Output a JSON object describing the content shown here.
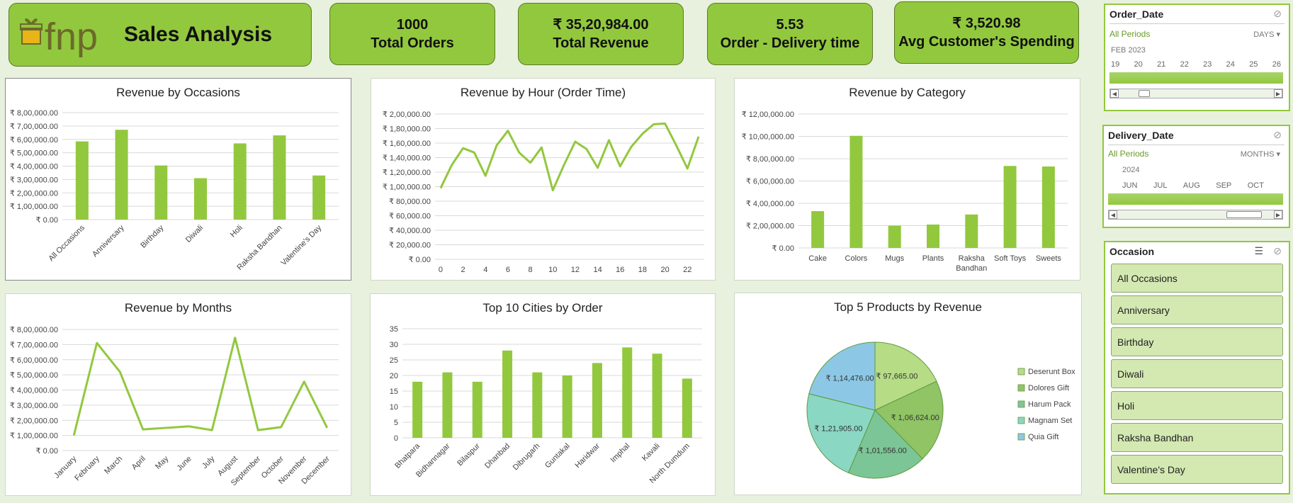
{
  "header": {
    "logo_text": "fnp",
    "title": "Sales Analysis"
  },
  "kpis": [
    {
      "value": "1000",
      "label": "Total Orders"
    },
    {
      "value": "₹ 35,20,984.00",
      "label": "Total Revenue"
    },
    {
      "value": "5.53",
      "label": "Order - Delivery time"
    },
    {
      "value": "₹ 3,520.98",
      "label": "Avg Customer's Spending"
    }
  ],
  "colors": {
    "accent": "#92c83e",
    "background": "#e8f1dd",
    "dark": "#5b7a28"
  },
  "slicers": {
    "order_date": {
      "title": "Order_Date",
      "all": "All Periods",
      "unit": "DAYS",
      "year": "FEB 2023",
      "ticks": [
        "19",
        "20",
        "21",
        "22",
        "23",
        "24",
        "25",
        "26"
      ]
    },
    "delivery_date": {
      "title": "Delivery_Date",
      "all": "All Periods",
      "unit": "MONTHS",
      "year": "2024",
      "ticks": [
        "JUN",
        "JUL",
        "AUG",
        "SEP",
        "OCT"
      ]
    },
    "occasion": {
      "title": "Occasion",
      "items": [
        "All Occasions",
        "Anniversary",
        "Birthday",
        "Diwali",
        "Holi",
        "Raksha Bandhan",
        "Valentine's Day"
      ]
    }
  },
  "chart_data": [
    {
      "id": "occasions",
      "type": "bar",
      "title": "Revenue by Occasions",
      "categories": [
        "All Occasions",
        "Anniversary",
        "Birthday",
        "Diwali",
        "Holi",
        "Raksha Bandhan",
        "Valentine's Day"
      ],
      "values": [
        585000,
        672000,
        405000,
        310000,
        570000,
        630000,
        330000
      ],
      "ylim": [
        0,
        800000
      ],
      "yticks": [
        "₹ 0.00",
        "₹ 1,00,000.00",
        "₹ 2,00,000.00",
        "₹ 3,00,000.00",
        "₹ 4,00,000.00",
        "₹ 5,00,000.00",
        "₹ 6,00,000.00",
        "₹ 7,00,000.00",
        "₹ 8,00,000.00"
      ]
    },
    {
      "id": "hour",
      "type": "line",
      "title": "Revenue by Hour (Order Time)",
      "x": [
        0,
        1,
        2,
        3,
        4,
        5,
        6,
        7,
        8,
        9,
        10,
        11,
        12,
        13,
        14,
        15,
        16,
        17,
        18,
        19,
        20,
        21,
        22,
        23
      ],
      "values": [
        98000,
        130000,
        153000,
        147000,
        115000,
        157000,
        177000,
        147000,
        133000,
        154000,
        95000,
        130000,
        162000,
        152000,
        126000,
        164000,
        128000,
        155000,
        173000,
        186000,
        187000,
        157000,
        125000,
        169000
      ],
      "ylim": [
        0,
        200000
      ],
      "xtick_labels": [
        "0",
        "2",
        "4",
        "6",
        "8",
        "10",
        "12",
        "14",
        "16",
        "18",
        "20",
        "22"
      ],
      "yticks": [
        "₹ 0.00",
        "₹ 20,000.00",
        "₹ 40,000.00",
        "₹ 60,000.00",
        "₹ 80,000.00",
        "₹ 1,00,000.00",
        "₹ 1,20,000.00",
        "₹ 1,40,000.00",
        "₹ 1,60,000.00",
        "₹ 1,80,000.00",
        "₹ 2,00,000.00"
      ]
    },
    {
      "id": "category",
      "type": "bar",
      "title": "Revenue by Category",
      "categories": [
        "Cake",
        "Colors",
        "Mugs",
        "Plants",
        "Raksha Bandhan",
        "Soft Toys",
        "Sweets"
      ],
      "values": [
        330000,
        1005000,
        200000,
        210000,
        300000,
        735000,
        730000
      ],
      "ylim": [
        0,
        1200000
      ],
      "yticks": [
        "₹ 0.00",
        "₹ 2,00,000.00",
        "₹ 4,00,000.00",
        "₹ 6,00,000.00",
        "₹ 8,00,000.00",
        "₹ 10,00,000.00",
        "₹ 12,00,000.00"
      ]
    },
    {
      "id": "months",
      "type": "line",
      "title": "Revenue by Months",
      "categories": [
        "January",
        "February",
        "March",
        "April",
        "May",
        "June",
        "July",
        "August",
        "September",
        "October",
        "November",
        "December"
      ],
      "values": [
        100000,
        710000,
        520000,
        140000,
        150000,
        160000,
        135000,
        745000,
        135000,
        155000,
        455000,
        150000
      ],
      "ylim": [
        0,
        800000
      ],
      "yticks": [
        "₹ 0.00",
        "₹ 1,00,000.00",
        "₹ 2,00,000.00",
        "₹ 3,00,000.00",
        "₹ 4,00,000.00",
        "₹ 5,00,000.00",
        "₹ 6,00,000.00",
        "₹ 7,00,000.00",
        "₹ 8,00,000.00"
      ]
    },
    {
      "id": "cities",
      "type": "bar",
      "title": "Top 10 Cities by Order",
      "categories": [
        "Bhatpara",
        "Bidhannagar",
        "Bilaspur",
        "Dhanbad",
        "Dibrugarh",
        "Guntakal",
        "Haridwar",
        "Imphal",
        "Kavali",
        "North Dumdum"
      ],
      "values": [
        18,
        21,
        18,
        28,
        21,
        20,
        24,
        29,
        27,
        19
      ],
      "ylim": [
        0,
        35
      ],
      "yticks": [
        "0",
        "5",
        "10",
        "15",
        "20",
        "25",
        "30",
        "35"
      ]
    },
    {
      "id": "products",
      "type": "pie",
      "title": "Top 5 Products by Revenue",
      "labels": [
        "Deserunt Box",
        "Dolores Gift",
        "Harum Pack",
        "Magnam Set",
        "Quia Gift"
      ],
      "values": [
        97665,
        106624,
        101556,
        121905,
        114476
      ],
      "value_labels": [
        "₹ 97,665.00",
        "₹ 1,06,624.00",
        "₹ 1,01,556.00",
        "₹ 1,21,905.00",
        "₹ 1,14,476.00"
      ],
      "colors": [
        "#b7dc86",
        "#90c464",
        "#7cc596",
        "#8ad7c4",
        "#8cc8e6"
      ]
    }
  ]
}
